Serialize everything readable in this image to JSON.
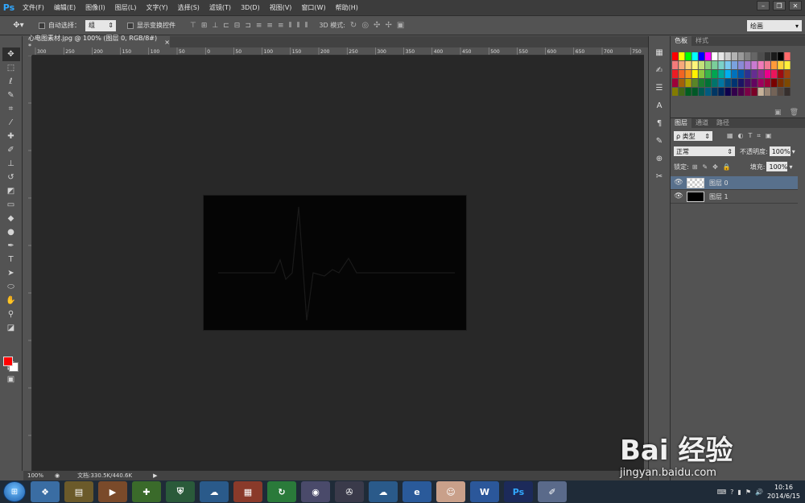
{
  "app": {
    "logo": "Ps",
    "menus": [
      "文件(F)",
      "编辑(E)",
      "图像(I)",
      "图层(L)",
      "文字(Y)",
      "选择(S)",
      "滤镜(T)",
      "3D(D)",
      "视图(V)",
      "窗口(W)",
      "帮助(H)"
    ]
  },
  "options": {
    "auto_select_label": "自动选择：",
    "auto_select_value": "组",
    "show_transform_label": "显示变换控件",
    "mode_3d_label": "3D 模式:",
    "workspace": "绘画"
  },
  "document": {
    "tab_title": "心电图素材.jpg @ 100% (图层 0, RGB/8#) *",
    "ruler_top_labels": [
      "300",
      "250",
      "200",
      "150",
      "100",
      "50",
      "0",
      "50",
      "100",
      "150",
      "200",
      "250",
      "300",
      "350",
      "400",
      "450",
      "500",
      "550",
      "600",
      "650",
      "700",
      "750"
    ]
  },
  "status": {
    "zoom": "100%",
    "doc_size": "文档:330.5K/440.6K"
  },
  "swatches_panel": {
    "tabs": [
      "色板",
      "样式"
    ]
  },
  "layers_panel": {
    "tabs": [
      "图层",
      "通道",
      "路径"
    ],
    "filter_type": "ρ 类型",
    "blend_mode": "正常",
    "opacity_label": "不透明度:",
    "opacity_value": "100%",
    "lock_label": "锁定:",
    "fill_label": "填充:",
    "fill_value": "100%",
    "layers": [
      {
        "name": "图层 0",
        "selected": true
      },
      {
        "name": "图层 1",
        "selected": false
      }
    ]
  },
  "taskbar": {
    "time": "10:16",
    "date": "2014/6/15"
  },
  "watermark": {
    "brand": "Bai 经验",
    "url": "jingyan.baidu.com"
  },
  "colors": {
    "foreground": "#ff0000",
    "background": "#ffffff",
    "ps_blue": "#31a8ff"
  }
}
